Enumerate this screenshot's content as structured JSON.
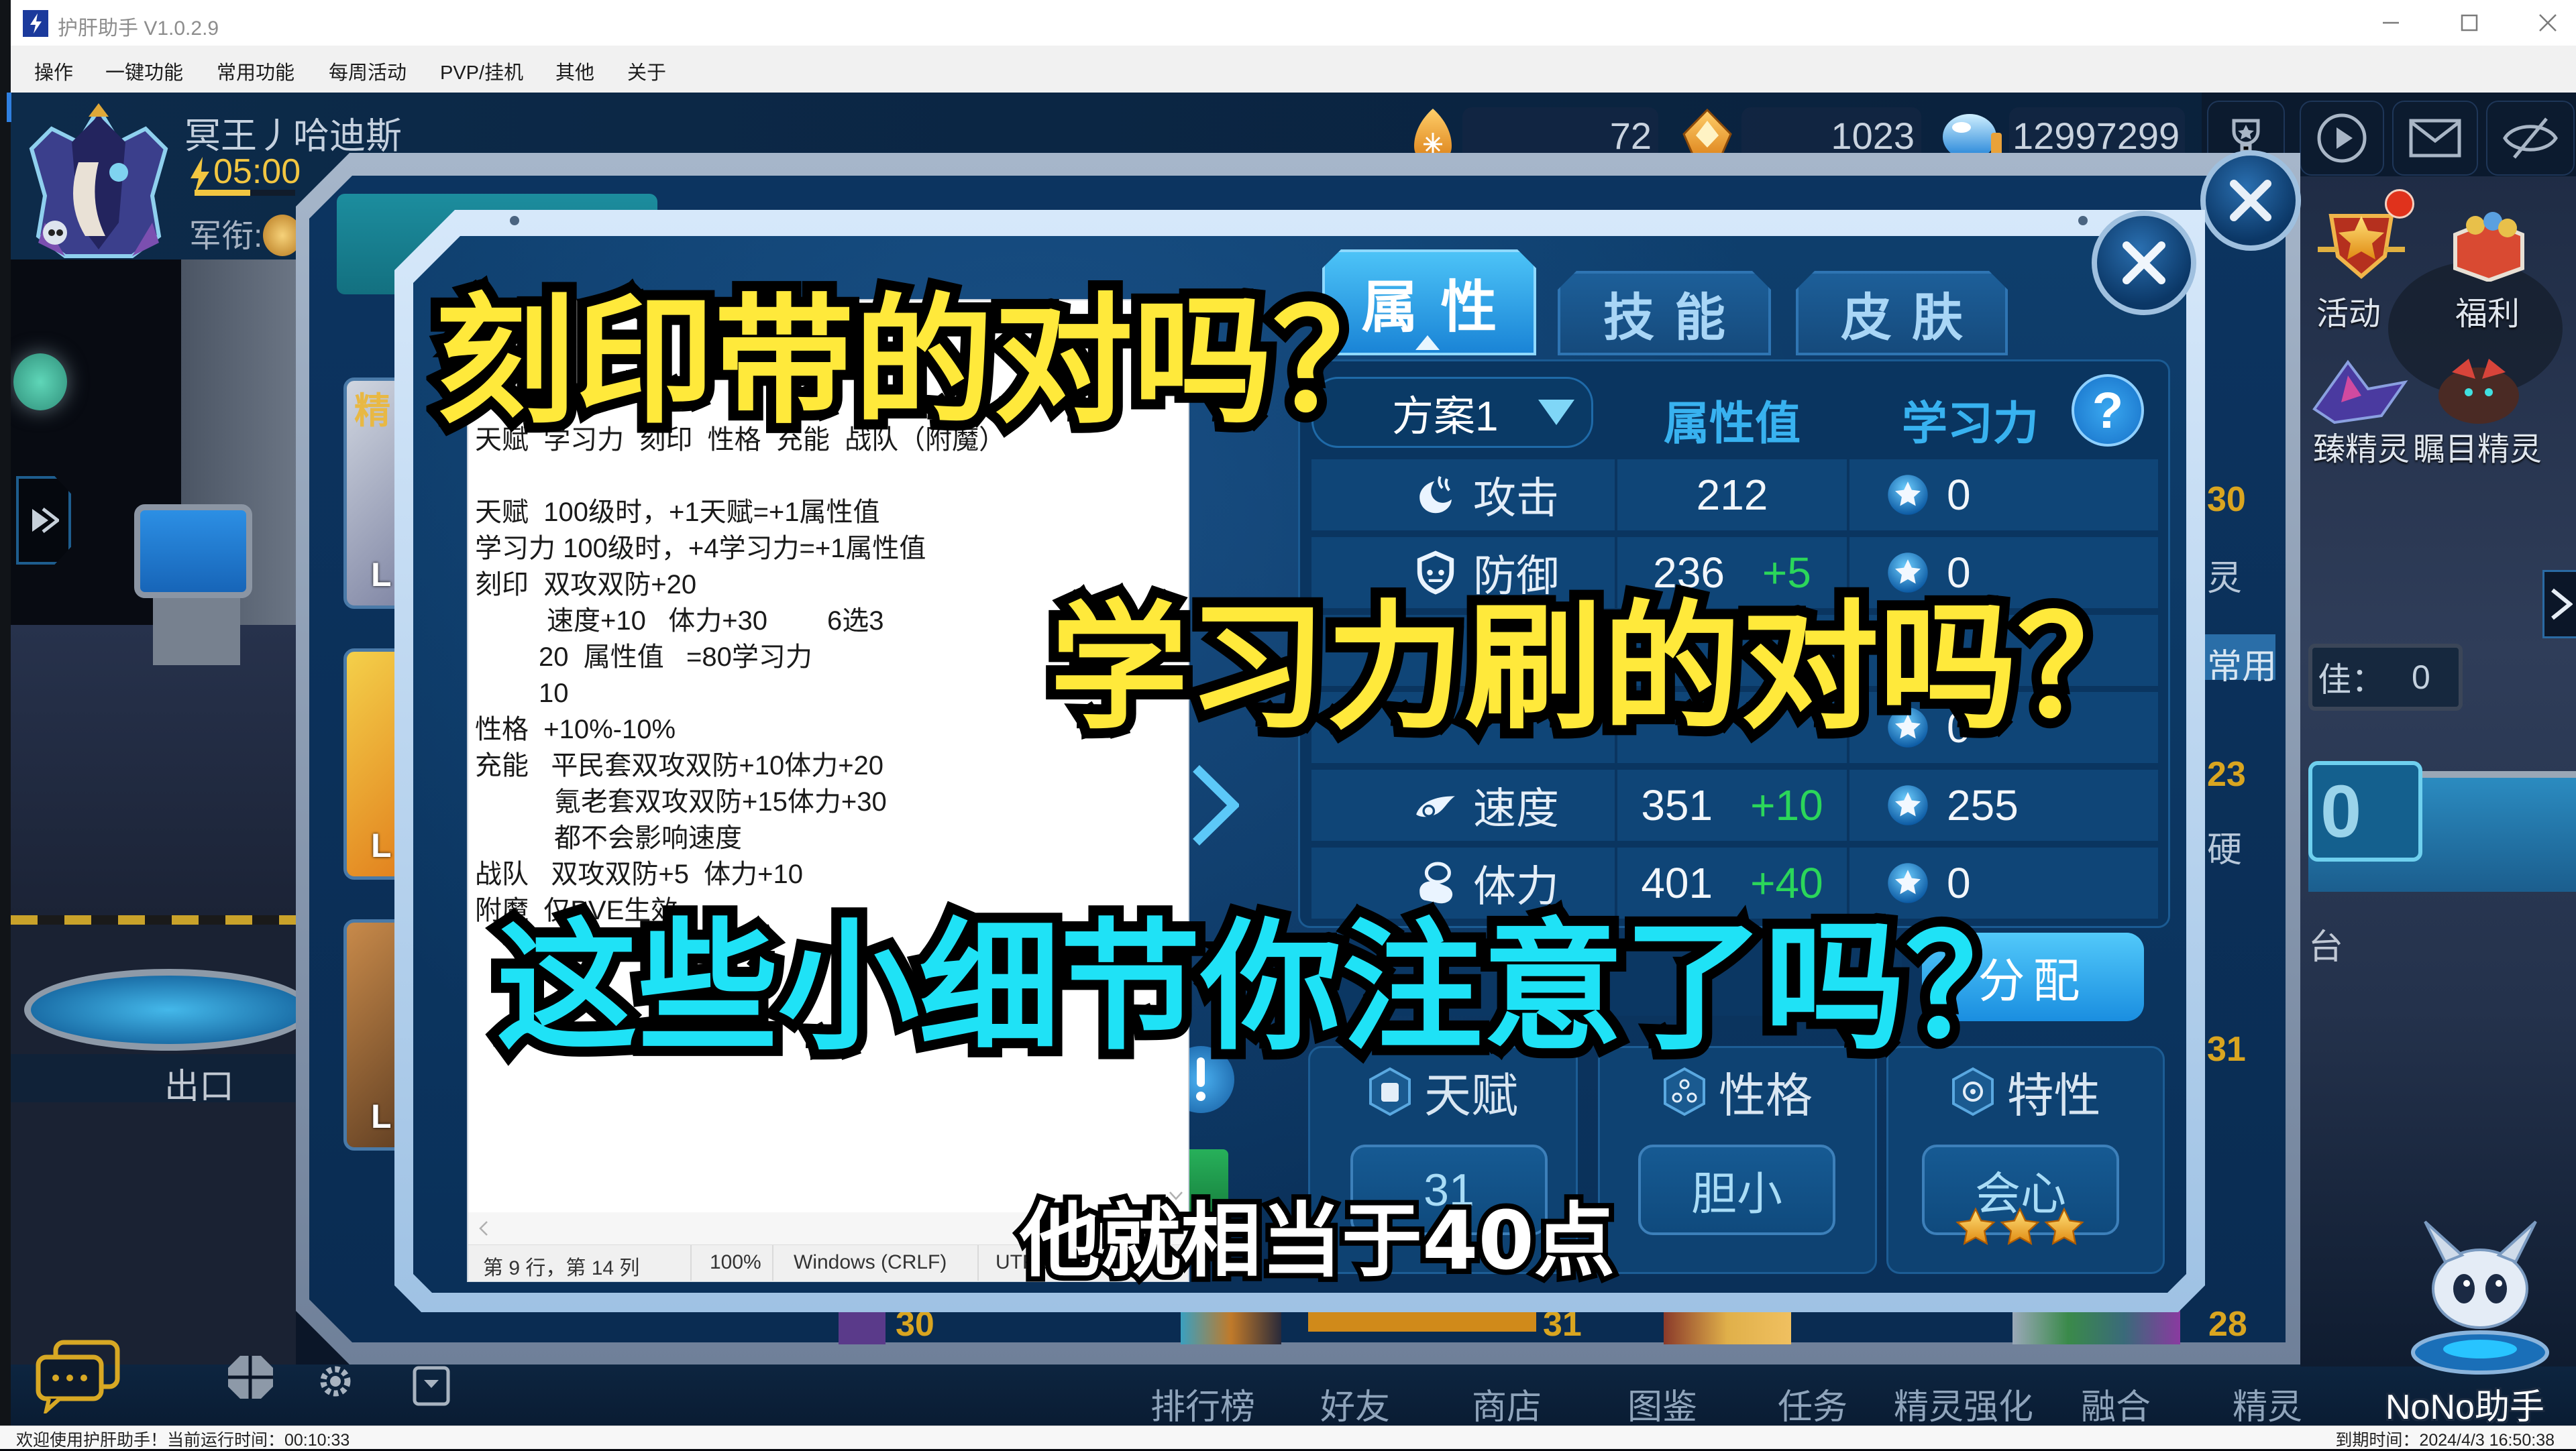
{
  "app": {
    "title": "护肝助手 V1.0.2.9"
  },
  "menu": [
    {
      "label": "操作"
    },
    {
      "label": "一键功能"
    },
    {
      "label": "常用功能"
    },
    {
      "label": "每周活动"
    },
    {
      "label": "PVP/挂机"
    },
    {
      "label": "其他"
    },
    {
      "label": "关于"
    }
  ],
  "game": {
    "player": {
      "name": "冥王丿哈迪斯",
      "energy_timer": "05:00",
      "energy_bar_fill": 0.55,
      "rank_label": "军衔:"
    },
    "resources": [
      {
        "icon": "orange-gem-icon",
        "value": "72"
      },
      {
        "icon": "gold-crystal-icon",
        "value": "1023"
      },
      {
        "icon": "blue-coin-icon",
        "value": "12997299"
      }
    ],
    "top_buttons": [
      {
        "icon": "trophy-icon"
      },
      {
        "icon": "play-icon"
      },
      {
        "icon": "mail-icon"
      },
      {
        "icon": "eye-off-icon"
      }
    ],
    "side_menu": [
      {
        "label": "活动",
        "notification": true
      },
      {
        "label": "福利",
        "notification": false
      },
      {
        "label": "臻精灵"
      },
      {
        "label": "瞩目精灵"
      }
    ],
    "scene": {
      "exit_label": "出口",
      "arena_label": "佳：",
      "arena_value": "0",
      "arena_big_value": "0",
      "platform_label": "台"
    },
    "back_panel": {
      "left_strip": {
        "tag": "精",
        "levels": [
          "L",
          "L",
          "L"
        ]
      },
      "right_strip": [
        "30",
        "灵",
        "常用",
        "23",
        "硬",
        "31"
      ],
      "bottom_numbers": [
        "30",
        "31",
        "28"
      ]
    },
    "bottom_nav": [
      {
        "label": "排行榜"
      },
      {
        "label": "好友"
      },
      {
        "label": "商店"
      },
      {
        "label": "图鉴"
      },
      {
        "label": "任务"
      },
      {
        "label": "精灵强化"
      },
      {
        "label": "融合"
      },
      {
        "label": "精灵"
      }
    ],
    "assistant_label": "NoNo助手"
  },
  "attribute_panel": {
    "tabs": [
      {
        "label": "属性",
        "active": true
      },
      {
        "label": "技能",
        "active": false
      },
      {
        "label": "皮肤",
        "active": false
      }
    ],
    "plan_select": {
      "value": "方案1"
    },
    "headers": {
      "value": "属性值",
      "learning": "学习力",
      "help": "?"
    },
    "rows": [
      {
        "name": "攻击",
        "icon": "attack-icon",
        "value": "212",
        "bonus": "",
        "learning": "0"
      },
      {
        "name": "防御",
        "icon": "defense-icon",
        "value": "236",
        "bonus": "+5",
        "learning": "0"
      },
      {
        "name": "",
        "value": "",
        "bonus": "",
        "learning": ""
      },
      {
        "name": "",
        "value": "",
        "bonus": "",
        "learning": "0"
      },
      {
        "name": "速度",
        "icon": "speed-icon",
        "value": "351",
        "bonus": "+10",
        "learning": "255"
      },
      {
        "name": "体力",
        "icon": "stamina-icon",
        "value": "401",
        "bonus": "+40",
        "learning": "0"
      }
    ],
    "distribute_button": "分配",
    "cards": [
      {
        "label": "天赋",
        "icon": "talent-icon",
        "value": "31"
      },
      {
        "label": "性格",
        "icon": "nature-icon",
        "value": "胆小"
      },
      {
        "label": "特性",
        "icon": "trait-icon",
        "value": "会心",
        "stars": 3
      }
    ]
  },
  "notepad": {
    "lines": [
      "天赋  学习力  刻印  性格  充能  战队（附魔）",
      "",
      "天赋  100级时，+1天赋=+1属性值",
      "学习力 100级时，+4学习力=+1属性值",
      "刻印  双攻双防+20",
      "速度+10   体力+30        6选3",
      "20  属性值   =80学习力",
      "10",
      "性格  +10%-10%",
      "充能   平民套双攻双防+10体力+20",
      "氪老套双攻双防+15体力+30",
      "都不会影响速度",
      "战队   双攻双防+5  体力+10",
      "附魔  仅PVE生效"
    ],
    "status": {
      "position": "第 9 行，第 14 列",
      "zoom": "100%",
      "line_ending": "Windows (CRLF)",
      "encoding": "UTF-8"
    }
  },
  "status_bar": {
    "left": "欢迎使用护肝助手！当前运行时间：00:10:33",
    "right": "到期时间：2024/4/3 16:50:38"
  },
  "captions": {
    "line1": "刻印带的对吗？",
    "line2": "学习力刷的对吗？",
    "line3": "这些小细节你注意了吗？",
    "subtitle": "他就相当于40点"
  },
  "colors": {
    "caption_yellow": "#FFE93B",
    "caption_cyan": "#1FE2F6",
    "bonus_green": "#2BD65A",
    "header_blue": "#38B2F0",
    "rank_gold": "#D9A520",
    "panel_navy": "#0D3A66"
  }
}
